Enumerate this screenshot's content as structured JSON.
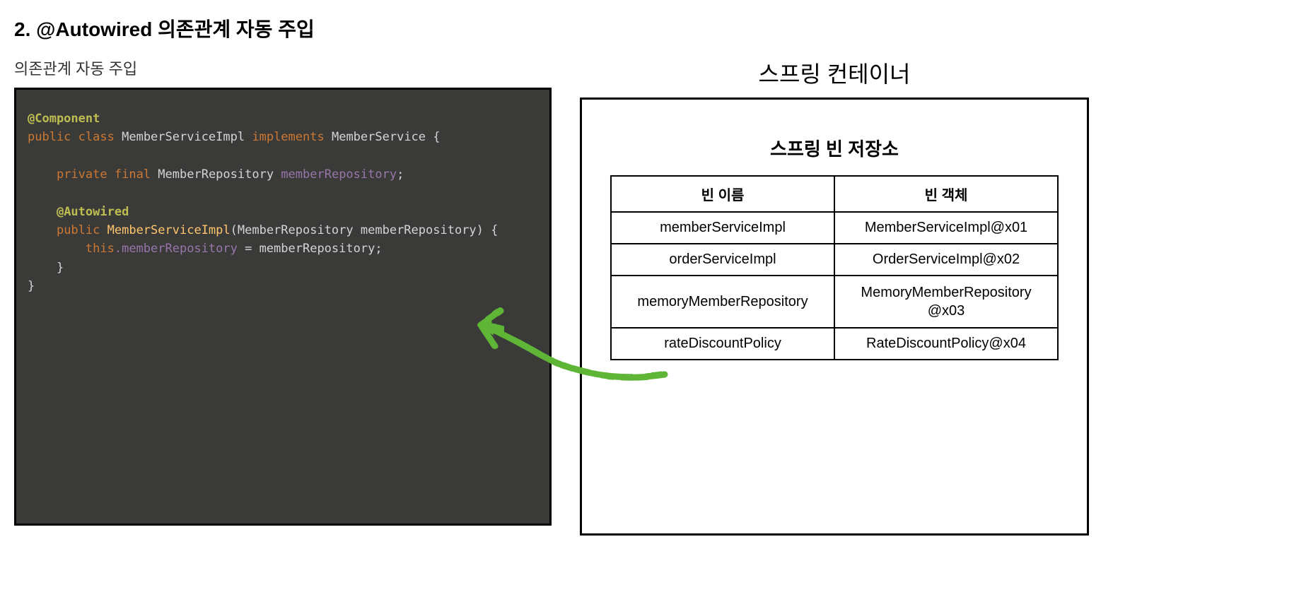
{
  "heading": "2. @Autowired 의존관계 자동 주입",
  "left": {
    "subtitle": "의존관계 자동 주입",
    "code": {
      "l1_annotation": "@Component",
      "l2_kw1": "public",
      "l2_kw2": "class",
      "l2_class": "MemberServiceImpl",
      "l2_kw3": "implements",
      "l2_iface": "MemberService",
      "l2_brace": " {",
      "l4_kw1": "private",
      "l4_kw2": "final",
      "l4_type": "MemberRepository",
      "l4_field": "memberRepository",
      "l4_semi": ";",
      "l6_annotation": "@Autowired",
      "l7_kw1": "public",
      "l7_ctor": "MemberServiceImpl",
      "l7_paren_open": "(",
      "l7_paramtype": "MemberRepository",
      "l7_paramname": "memberRepository",
      "l7_paren_close": ") {",
      "l8_this": "this",
      "l8_dot_field": ".memberRepository",
      "l8_eq": " = ",
      "l8_rhs": "memberRepository",
      "l8_semi": ";",
      "l9_brace": "}",
      "l10_brace": "}"
    }
  },
  "right": {
    "containerTitle": "스프링 컨테이너",
    "storageTitle": "스프링 빈 저장소",
    "table": {
      "header": {
        "col1": "빈 이름",
        "col2": "빈 객체"
      },
      "rows": [
        {
          "name": "memberServiceImpl",
          "obj": "MemberServiceImpl@x01"
        },
        {
          "name": "orderServiceImpl",
          "obj": "OrderServiceImpl@x02"
        },
        {
          "name": "memoryMemberRepository",
          "obj": "MemoryMemberRepository@x03"
        },
        {
          "name": "rateDiscountPolicy",
          "obj": "RateDiscountPolicy@x04"
        }
      ]
    }
  },
  "arrow": {
    "color": "#5fb536"
  }
}
